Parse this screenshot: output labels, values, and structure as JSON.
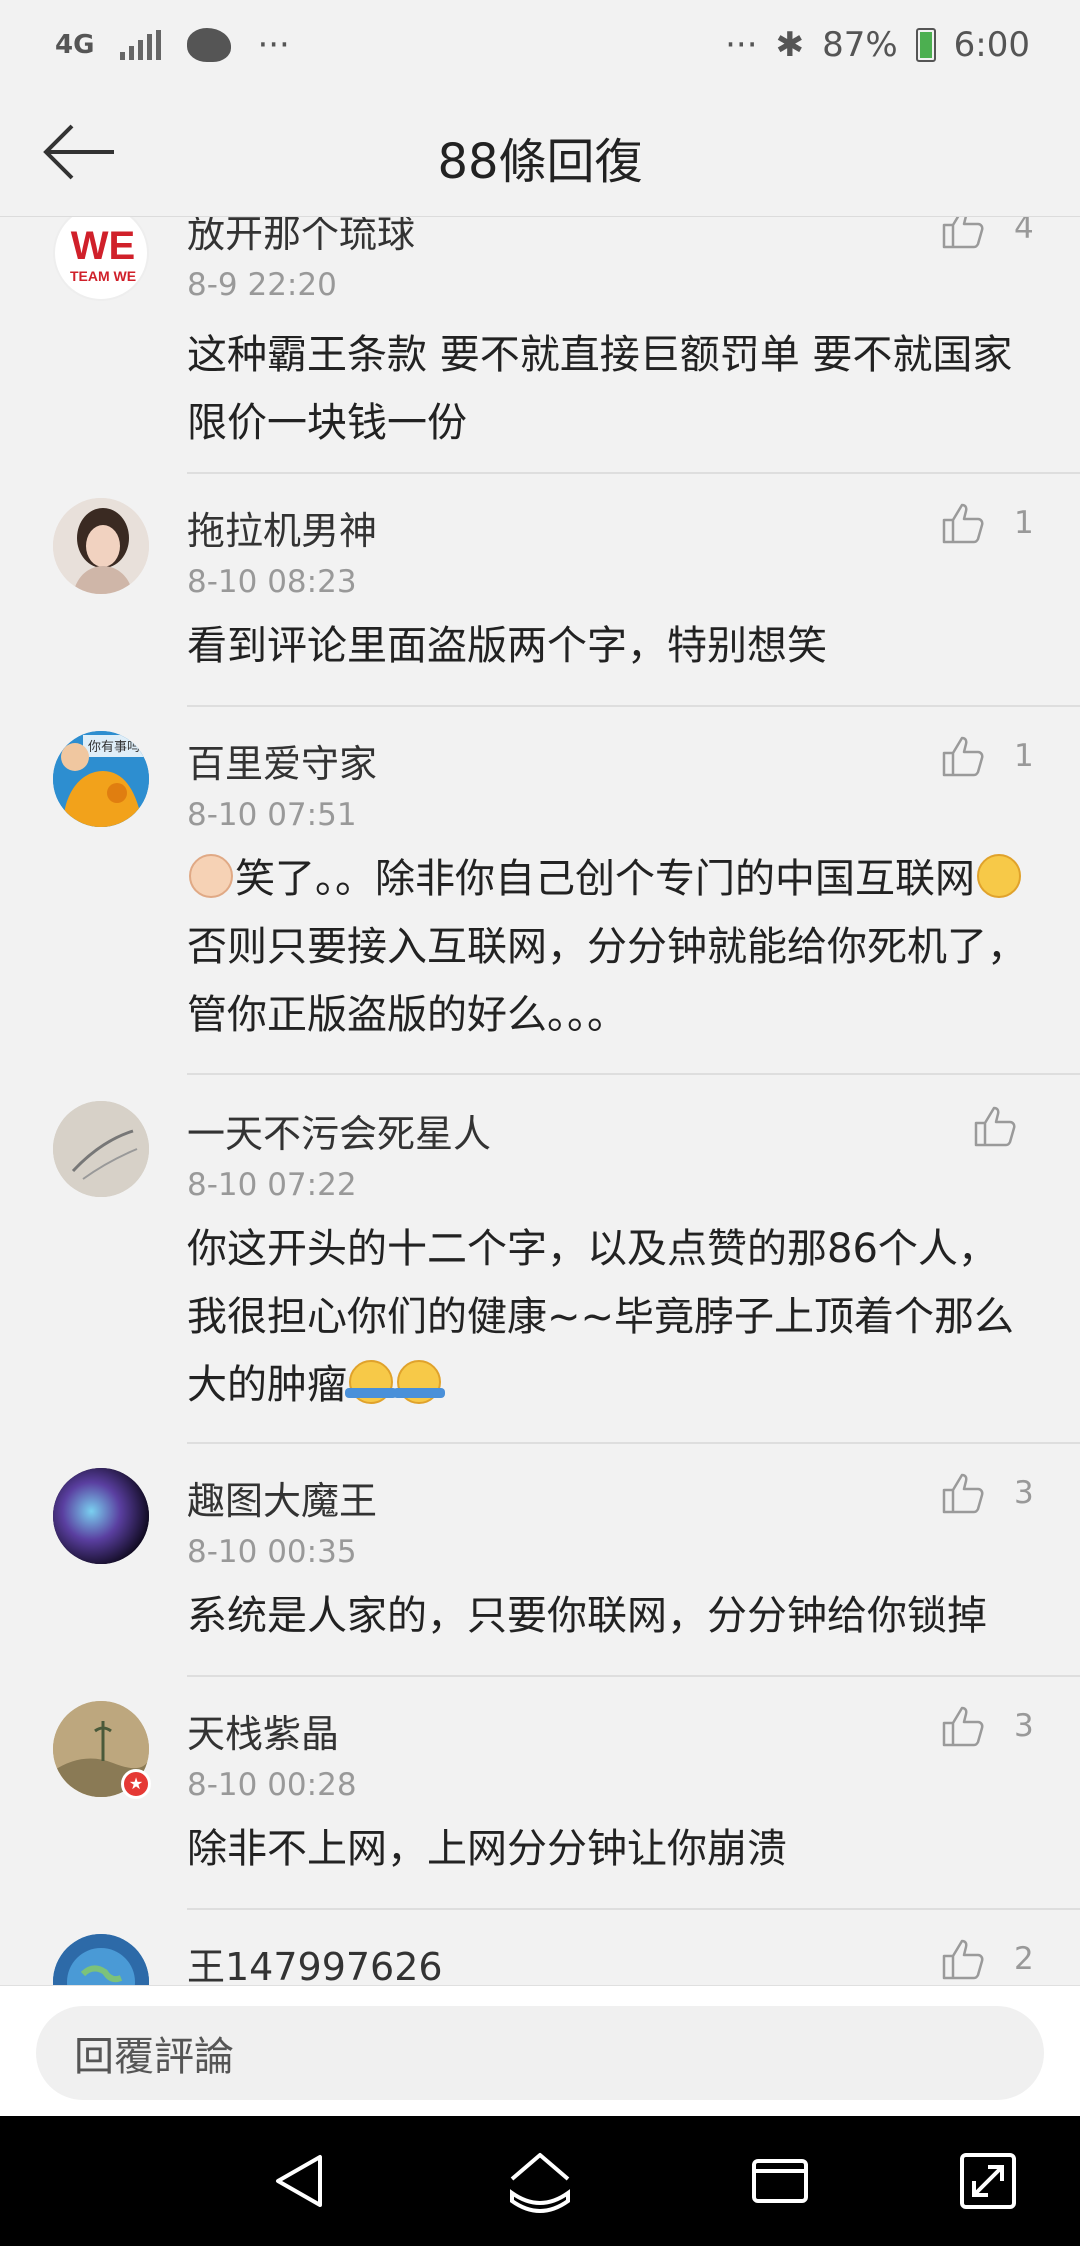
{
  "status": {
    "network": "4G",
    "dots_left": "···",
    "dots_right": "···",
    "battery": "87%",
    "time": "6:00"
  },
  "header": {
    "title": "88條回復"
  },
  "comments": [
    {
      "name": "放开那个琉球",
      "time": "8-9 22:20",
      "text": "这种霸王条款  要不就直接巨额罚单  要不就国家限价一块钱一份",
      "likes": "4",
      "avatar_label": "TEAM WE"
    },
    {
      "name": "拖拉机男神",
      "time": "8-10 08:23",
      "text": "看到评论里面盗版两个字，特别想笑",
      "likes": "1"
    },
    {
      "name": "百里爱守家",
      "time": "8-10 07:51",
      "text_a": "笑了。。除非你自己创个专门的中国互联网",
      "text_b": "否则只要接入互联网，分分钟就能给你死机了，管你正版盗版的好么。。。",
      "likes": "1",
      "avatar_label": "你有事吗"
    },
    {
      "name": "一天不污会死星人",
      "time": "8-10 07:22",
      "text": "你这开头的十二个字，以及点赞的那86个人，我很担心你们的健康~~毕竟脖子上顶着个那么大的肿瘤",
      "likes": ""
    },
    {
      "name": "趣图大魔王",
      "time": "8-10 00:35",
      "text": "系统是人家的，只要你联网，分分钟给你锁掉",
      "likes": "3"
    },
    {
      "name": "天栈紫晶",
      "time": "8-10 00:28",
      "text": "除非不上网，上网分分钟让你崩溃",
      "likes": "3"
    },
    {
      "name": "王147997626",
      "time": "",
      "text": "",
      "likes": "2"
    }
  ],
  "input": {
    "placeholder": "回覆評論"
  },
  "colors": {
    "background": "#f2f2f2",
    "text_primary": "#222222",
    "text_secondary": "#999999",
    "navbar": "#000000"
  },
  "icons": [
    "back-arrow-icon",
    "thumbs-up-icon",
    "nav-back-icon",
    "nav-home-icon",
    "nav-recents-icon",
    "nav-rotate-icon"
  ]
}
